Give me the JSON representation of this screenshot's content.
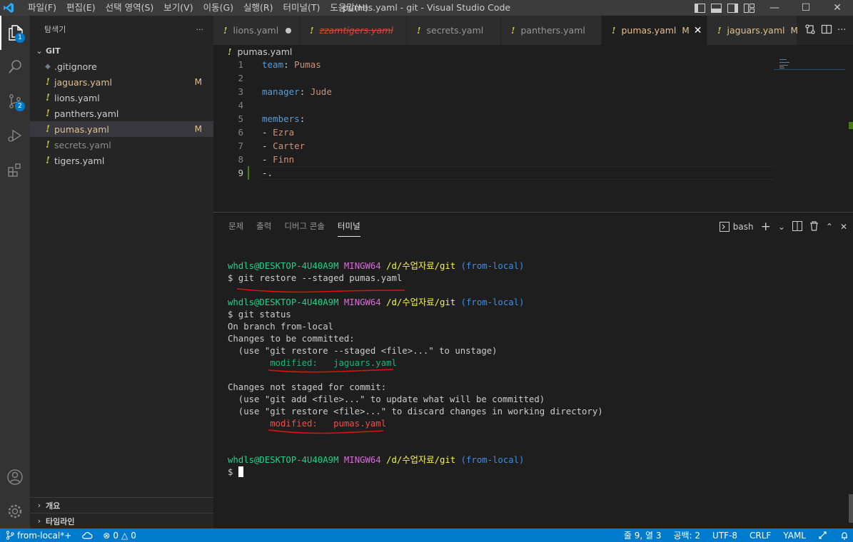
{
  "window": {
    "title": "pumas.yaml - git - Visual Studio Code",
    "menu": [
      "파일(F)",
      "편집(E)",
      "선택 영역(S)",
      "보기(V)",
      "이동(G)",
      "실행(R)",
      "터미널(T)",
      "도움말(H)"
    ]
  },
  "activity": {
    "explorer_badge": "1",
    "scm_badge": "2"
  },
  "sidebar": {
    "header": "탐색기",
    "more": "···",
    "folder": "GIT",
    "files": [
      {
        "name": ".gitignore",
        "state": ""
      },
      {
        "name": "jaguars.yaml",
        "state": "M"
      },
      {
        "name": "lions.yaml",
        "state": ""
      },
      {
        "name": "panthers.yaml",
        "state": ""
      },
      {
        "name": "pumas.yaml",
        "state": "M"
      },
      {
        "name": "secrets.yaml",
        "state": ""
      },
      {
        "name": "tigers.yaml",
        "state": ""
      }
    ],
    "outline": "개요",
    "timeline": "타임라인"
  },
  "tabs": [
    {
      "name": "lions.yaml"
    },
    {
      "name": "zzamtigers.yaml"
    },
    {
      "name": "secrets.yaml"
    },
    {
      "name": "panthers.yaml"
    },
    {
      "name": "pumas.yaml",
      "state": "M"
    },
    {
      "name": "jaguars.yaml",
      "state": "M"
    }
  ],
  "breadcrumb": "pumas.yaml",
  "editor": {
    "lines": [
      {
        "num": "1",
        "key": "team",
        "sep": ": ",
        "val": "Pumas"
      },
      {
        "num": "2",
        "key": "",
        "sep": "",
        "val": ""
      },
      {
        "num": "3",
        "key": "manager",
        "sep": ": ",
        "val": "Jude"
      },
      {
        "num": "4",
        "key": "",
        "sep": "",
        "val": ""
      },
      {
        "num": "5",
        "key": "members",
        "sep": ":",
        "val": ""
      },
      {
        "num": "6",
        "dash": "- ",
        "val": "Ezra"
      },
      {
        "num": "7",
        "dash": "- ",
        "val": "Carter"
      },
      {
        "num": "8",
        "dash": "- ",
        "val": "Finn"
      },
      {
        "num": "9",
        "dash": "-.",
        "val": ""
      }
    ]
  },
  "panel": {
    "tabs": [
      "문제",
      "출력",
      "디버그 콘솔",
      "터미널"
    ],
    "shell": "bash",
    "terminal": {
      "user": "whdls@DESKTOP-4U40A9M",
      "system": "MINGW64",
      "path": "/d/수업자료/git",
      "branch": "(from-local)",
      "cmd1": "$ git restore --staged pumas.yaml",
      "cmd2": "$ git status",
      "out1": "On branch from-local",
      "out2": "Changes to be committed:",
      "out3": "  (use \"git restore --staged <file>...\" to unstage)",
      "staged": "        modified:   jaguars.yaml",
      "out4": "Changes not staged for commit:",
      "out5": "  (use \"git add <file>...\" to update what will be committed)",
      "out6": "  (use \"git restore <file>...\" to discard changes in working directory)",
      "unstaged": "        modified:   pumas.yaml",
      "prompt": "$ "
    }
  },
  "statusbar": {
    "branch": "from-local*+",
    "errors": "0",
    "warnings": "0",
    "position": "줄 9, 열 3",
    "indent": "공백: 2",
    "encoding": "UTF-8",
    "eol": "CRLF",
    "language": "YAML"
  },
  "colors": {
    "accent": "#007acc",
    "modified": "#e2c08d",
    "deleted": "#c74e39",
    "yaml_icon": "#cbcb41"
  }
}
